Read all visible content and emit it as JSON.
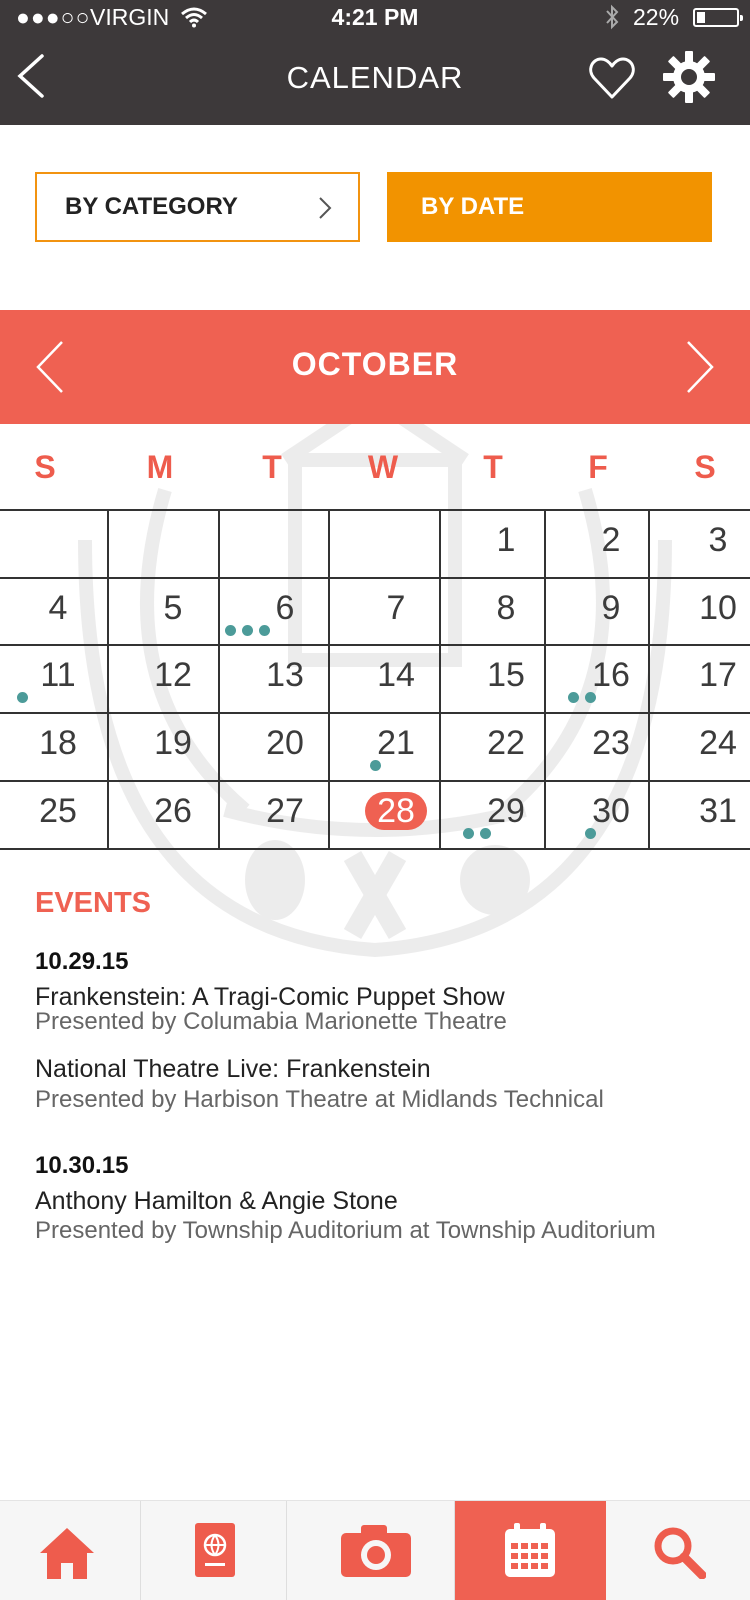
{
  "status_bar": {
    "signal": "●●●○○",
    "carrier": "VIRGIN",
    "time": "4:21 PM",
    "battery_percent": "22%",
    "battery_level": 0.22
  },
  "nav": {
    "title": "CALENDAR",
    "back_icon": "back-chevron-icon",
    "favorite_icon": "heart-icon",
    "settings_icon": "gear-icon"
  },
  "filters": {
    "category_label": "BY CATEGORY",
    "date_label": "BY DATE",
    "active": "date"
  },
  "calendar": {
    "month": "OCTOBER",
    "weekdays": [
      "S",
      "M",
      "T",
      "W",
      "T",
      "F",
      "S"
    ],
    "days": [
      1,
      2,
      3,
      4,
      5,
      6,
      7,
      8,
      9,
      10,
      11,
      12,
      13,
      14,
      15,
      16,
      17,
      18,
      19,
      20,
      21,
      22,
      23,
      24,
      25,
      26,
      27,
      28,
      29,
      30,
      31
    ],
    "first_weekday_index": 4,
    "today": 28,
    "event_dots": {
      "6": 3,
      "11": 1,
      "16": 2,
      "21": 1,
      "29": 2,
      "30": 1
    }
  },
  "events": {
    "heading": "EVENTS",
    "groups": [
      {
        "date": "10.29.15",
        "items": [
          {
            "title": "Frankenstein: A Tragi-Comic Puppet Show",
            "presenter": "Presented by Columabia Marionette Theatre"
          },
          {
            "title": "National Theatre Live: Frankenstein",
            "presenter": "Presented by Harbison Theatre at Midlands Technical"
          }
        ]
      },
      {
        "date": "10.30.15",
        "items": [
          {
            "title": "Anthony Hamilton & Angie Stone",
            "presenter": "Presented by Township Auditorium at Township Auditorium"
          }
        ]
      }
    ]
  },
  "tabbar": {
    "tabs": [
      "home-icon",
      "passport-icon",
      "camera-icon",
      "calendar-icon",
      "search-icon"
    ],
    "active": "calendar-icon"
  },
  "colors": {
    "header_bg": "#3d393a",
    "accent_red": "#ef6152",
    "accent_orange": "#f29300",
    "dot_teal": "#4c9b99"
  }
}
